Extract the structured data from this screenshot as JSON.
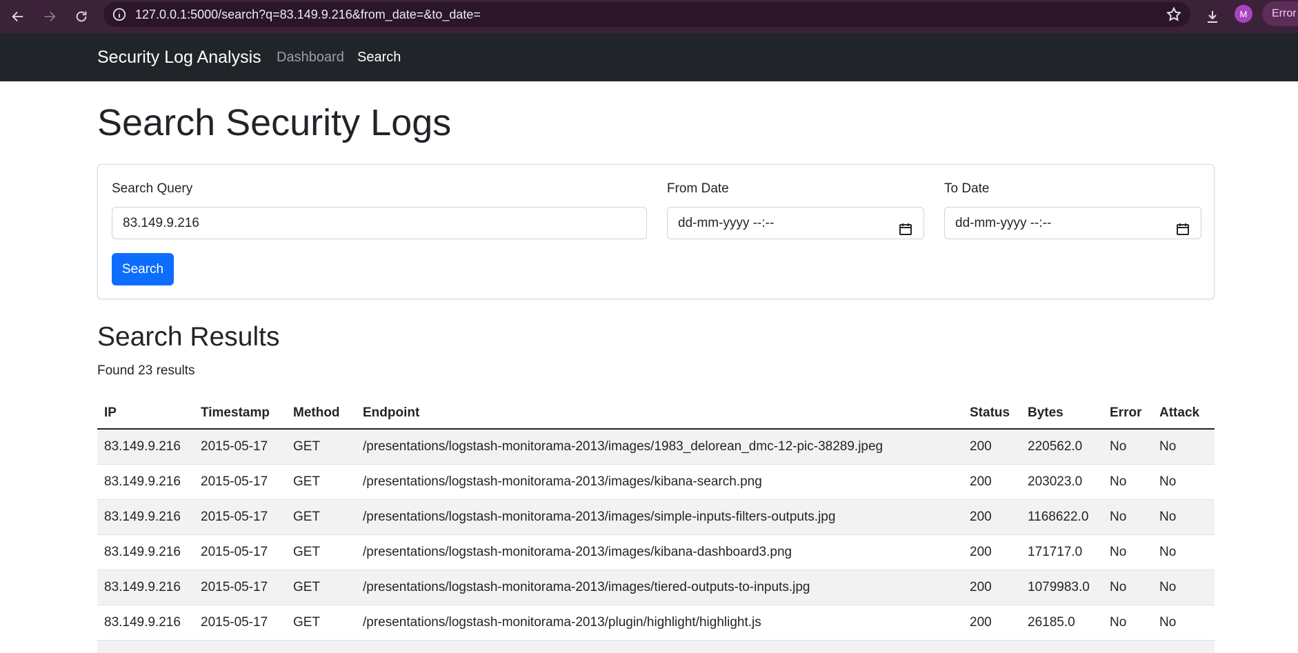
{
  "browser": {
    "url": "127.0.0.1:5000/search?q=83.149.9.216&from_date=&to_date=",
    "profile_initial": "M",
    "error_label": "Error"
  },
  "navbar": {
    "brand": "Security Log Analysis",
    "links": [
      "Dashboard",
      "Search"
    ],
    "active_link": "Search"
  },
  "page": {
    "title": "Search Security Logs"
  },
  "search_form": {
    "query_label": "Search Query",
    "query_value": "83.149.9.216",
    "from_label": "From Date",
    "from_placeholder": "dd-mm-yyyy --:--",
    "to_label": "To Date",
    "to_placeholder": "dd-mm-yyyy --:--",
    "submit_label": "Search"
  },
  "results": {
    "title": "Search Results",
    "count_text": "Found 23 results",
    "columns": [
      "IP",
      "Timestamp",
      "Method",
      "Endpoint",
      "Status",
      "Bytes",
      "Error",
      "Attack"
    ],
    "rows": [
      [
        "83.149.9.216",
        "2015-05-17",
        "GET",
        "/presentations/logstash-monitorama-2013/images/1983_delorean_dmc-12-pic-38289.jpeg",
        "200",
        "220562.0",
        "No",
        "No"
      ],
      [
        "83.149.9.216",
        "2015-05-17",
        "GET",
        "/presentations/logstash-monitorama-2013/images/kibana-search.png",
        "200",
        "203023.0",
        "No",
        "No"
      ],
      [
        "83.149.9.216",
        "2015-05-17",
        "GET",
        "/presentations/logstash-monitorama-2013/images/simple-inputs-filters-outputs.jpg",
        "200",
        "1168622.0",
        "No",
        "No"
      ],
      [
        "83.149.9.216",
        "2015-05-17",
        "GET",
        "/presentations/logstash-monitorama-2013/images/kibana-dashboard3.png",
        "200",
        "171717.0",
        "No",
        "No"
      ],
      [
        "83.149.9.216",
        "2015-05-17",
        "GET",
        "/presentations/logstash-monitorama-2013/images/tiered-outputs-to-inputs.jpg",
        "200",
        "1079983.0",
        "No",
        "No"
      ],
      [
        "83.149.9.216",
        "2015-05-17",
        "GET",
        "/presentations/logstash-monitorama-2013/plugin/highlight/highlight.js",
        "200",
        "26185.0",
        "No",
        "No"
      ]
    ]
  }
}
